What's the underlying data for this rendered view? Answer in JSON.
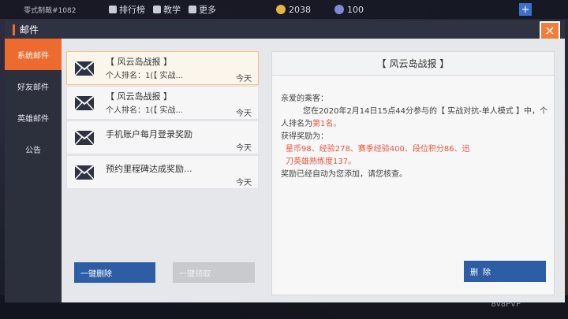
{
  "topbar": {
    "player_name": "零式制裁#1082",
    "leaderboard": "排行榜",
    "tutorial": "教学",
    "more": "更多",
    "coins": "2038",
    "gems": "100",
    "plus": "+"
  },
  "bottombar": {
    "mode_label": "8v8PVP"
  },
  "dialog": {
    "title": "邮件",
    "close_label": "×"
  },
  "sidebar": {
    "items": [
      {
        "label": "系统邮件",
        "active": true
      },
      {
        "label": "好友邮件",
        "active": false
      },
      {
        "label": "英雄邮件",
        "active": false
      },
      {
        "label": "公告",
        "active": false
      }
    ]
  },
  "mail_list": [
    {
      "title": "【 风云岛战报 】",
      "subtitle": "个人排名：1(【 实战...",
      "date": "今天",
      "selected": true
    },
    {
      "title": "【 风云岛战报 】",
      "subtitle": "个人排名：1(【 实战...",
      "date": "今天",
      "selected": false
    },
    {
      "title": "手机账户每月登录奖励",
      "subtitle": "",
      "date": "今天",
      "selected": false
    },
    {
      "title": "预约里程碑达成奖励...",
      "subtitle": "",
      "date": "今天",
      "selected": false
    }
  ],
  "buttons": {
    "batch_delete": "一键删除",
    "batch_claim": "一键领取",
    "delete": "删除"
  },
  "detail": {
    "title": "【 风云岛战报 】",
    "greeting": "亲爱的乘客：",
    "body_prefix": "您在2020年2月14日15点44分参与的【 实战对抗-单人模式 】中，个人排名为",
    "rank": "第1名。",
    "reward_title": "获得奖励为：",
    "reward_items": "星币98、经验278、赛季经验400、段位积分86、迅刀英雄熟练度137。",
    "closing": "奖励已经自动为您添加，请您核查。"
  }
}
